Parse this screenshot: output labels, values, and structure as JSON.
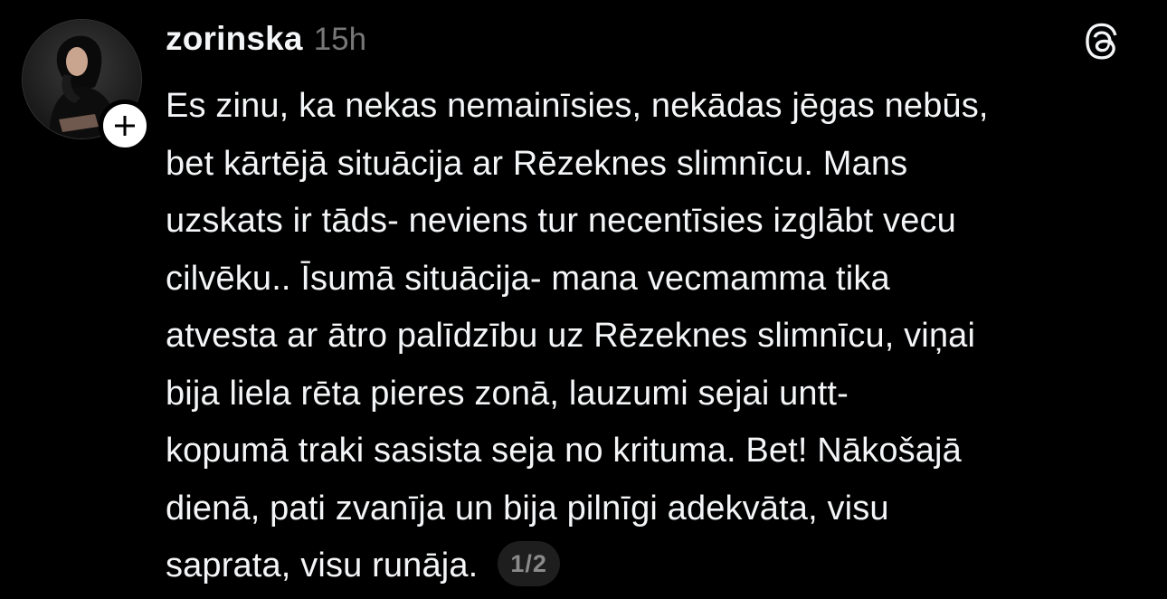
{
  "post": {
    "username": "zorinska",
    "timestamp": "15h",
    "lines": [
      "Es zinu, ka nekas nemainīsies, nekādas jēgas nebūs,",
      "bet kārtējā situācija ar Rēzeknes slimnīcu. Mans",
      "uzskats ir tāds- neviens tur necentīsies izglābt vecu",
      "cilvēku.. Īsumā situācija- mana vecmamma tika",
      "atvesta ar ātro palīdzību uz Rēzeknes slimnīcu, viņai",
      "bija liela rēta pieres zonā, lauzumi sejai untt-",
      "kopumā traki sasista seja no krituma. Bet! Nākošajā",
      "dienā, pati zvanīja un bija pilnīgi adekvāta, visu",
      "saprata, visu runāja."
    ],
    "page_indicator": "1/2"
  },
  "icons": {
    "avatar": "profile-photo",
    "follow": "plus-icon",
    "brand": "threads-logo-icon"
  },
  "colors": {
    "background": "#000000",
    "text": "#f3f5f7",
    "muted": "#777777",
    "pill": "#1e1e1e"
  }
}
